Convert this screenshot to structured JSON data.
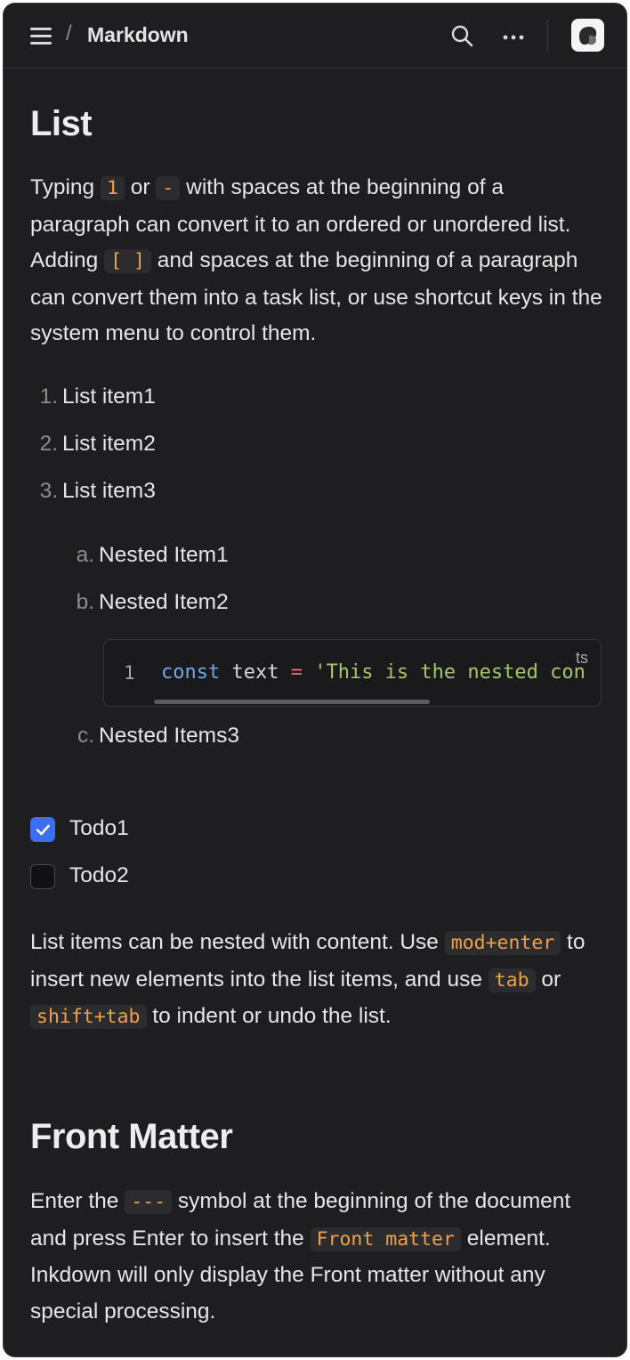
{
  "header": {
    "separator": "/",
    "title": "Markdown"
  },
  "list_section": {
    "heading": "List",
    "intro": {
      "t1": "Typing ",
      "c1": "1",
      "t2": " or ",
      "c2": "-",
      "t3": " with spaces at the beginning of a paragraph can convert it to an ordered or unordered list. Adding ",
      "c3": "[ ]",
      "t4": " and spaces at the beginning of a paragraph can convert them into a task list, or use shortcut keys in the system menu to control them."
    },
    "ordered": [
      {
        "marker": "1.",
        "label": "List item1"
      },
      {
        "marker": "2.",
        "label": "List item2"
      },
      {
        "marker": "3.",
        "label": "List item3"
      }
    ],
    "nested": [
      {
        "marker": "a.",
        "label": "Nested Item1"
      },
      {
        "marker": "b.",
        "label": "Nested Item2"
      },
      {
        "marker": "c.",
        "label": "Nested Items3"
      }
    ],
    "code": {
      "line_number": "1",
      "keyword": "const",
      "identifier": " text ",
      "operator": "=",
      "string": " 'This is the nested con",
      "language": "ts"
    },
    "todos": [
      {
        "label": "Todo1",
        "checked": true
      },
      {
        "label": "Todo2",
        "checked": false
      }
    ],
    "nesting_note": {
      "t1": "List items can be nested with content. Use ",
      "c1": "mod+enter",
      "t2": " to insert new elements into the list items, and use ",
      "c2": "tab",
      "t3": " or ",
      "c3": "shift+tab",
      "t4": " to indent or undo the list."
    }
  },
  "front_matter_section": {
    "heading": "Front Matter",
    "body": {
      "t1": "Enter the ",
      "c1": "---",
      "t2": " symbol at the beginning of the document and press Enter to insert the ",
      "c2": "Front matter",
      "t3": " element. Inkdown will only display the Front matter without any special processing."
    }
  },
  "colors": {
    "background": "#1e1e20",
    "inline_code": "#f0a14b",
    "checkbox_checked": "#3b6ef0"
  },
  "icons": [
    "menu-icon",
    "search-icon",
    "more-icon",
    "app-logo-icon",
    "check-icon"
  ]
}
